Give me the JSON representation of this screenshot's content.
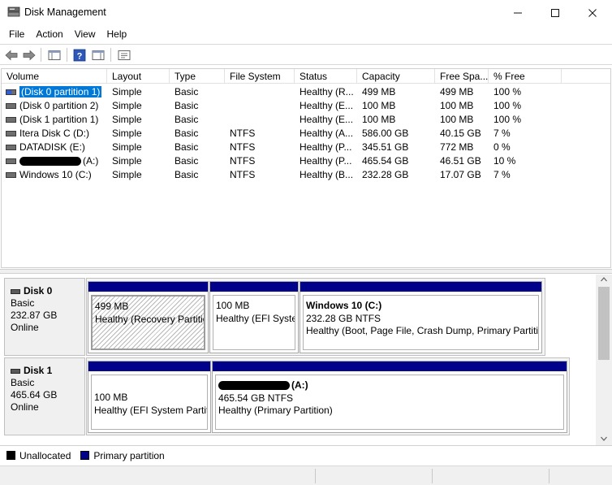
{
  "window": {
    "title": "Disk Management"
  },
  "menu": [
    "File",
    "Action",
    "View",
    "Help"
  ],
  "volume_list": {
    "columns": [
      "Volume",
      "Layout",
      "Type",
      "File System",
      "Status",
      "Capacity",
      "Free Spa...",
      "% Free"
    ],
    "rows": [
      {
        "volume": "(Disk 0 partition 1)",
        "layout": "Simple",
        "type": "Basic",
        "fs": "",
        "status": "Healthy (R...",
        "capacity": "499 MB",
        "free": "499 MB",
        "pct": "100 %"
      },
      {
        "volume": "(Disk 0 partition 2)",
        "layout": "Simple",
        "type": "Basic",
        "fs": "",
        "status": "Healthy (E...",
        "capacity": "100 MB",
        "free": "100 MB",
        "pct": "100 %"
      },
      {
        "volume": "(Disk 1 partition 1)",
        "layout": "Simple",
        "type": "Basic",
        "fs": "",
        "status": "Healthy (E...",
        "capacity": "100 MB",
        "free": "100 MB",
        "pct": "100 %"
      },
      {
        "volume": "Itera Disk C (D:)",
        "layout": "Simple",
        "type": "Basic",
        "fs": "NTFS",
        "status": "Healthy (A...",
        "capacity": "586.00 GB",
        "free": "40.15 GB",
        "pct": "7 %"
      },
      {
        "volume": "DATADISK (E:)",
        "layout": "Simple",
        "type": "Basic",
        "fs": "NTFS",
        "status": "Healthy (P...",
        "capacity": "345.51 GB",
        "free": "772 MB",
        "pct": "0 %"
      },
      {
        "volume": "(A:)",
        "layout": "Simple",
        "type": "Basic",
        "fs": "NTFS",
        "status": "Healthy (P...",
        "capacity": "465.54 GB",
        "free": "46.51 GB",
        "pct": "10 %"
      },
      {
        "volume": "Windows 10 (C:)",
        "layout": "Simple",
        "type": "Basic",
        "fs": "NTFS",
        "status": "Healthy (B...",
        "capacity": "232.28 GB",
        "free": "17.07 GB",
        "pct": "7 %"
      }
    ]
  },
  "disks": [
    {
      "name": "Disk 0",
      "type": "Basic",
      "size": "232.87 GB",
      "state": "Online",
      "partitions": [
        {
          "title": "",
          "size": "499 MB",
          "status": "Healthy (Recovery Partitic"
        },
        {
          "title": "",
          "size": "100 MB",
          "status": "Healthy (EFI Syster"
        },
        {
          "title": "Windows 10  (C:)",
          "size": "232.28 GB NTFS",
          "status": "Healthy (Boot, Page File, Crash Dump, Primary Partitio"
        }
      ]
    },
    {
      "name": "Disk 1",
      "type": "Basic",
      "size": "465.64 GB",
      "state": "Online",
      "partitions": [
        {
          "title": "",
          "size": "100 MB",
          "status": "Healthy (EFI System Partiti"
        },
        {
          "title": "(A:)",
          "size": "465.54 GB NTFS",
          "status": "Healthy (Primary Partition)"
        }
      ]
    }
  ],
  "legend": {
    "unallocated": "Unallocated",
    "primary": "Primary partition"
  },
  "colors": {
    "partition_bar": "#00008b",
    "selection": "#0078d7",
    "unallocated": "#000000"
  }
}
